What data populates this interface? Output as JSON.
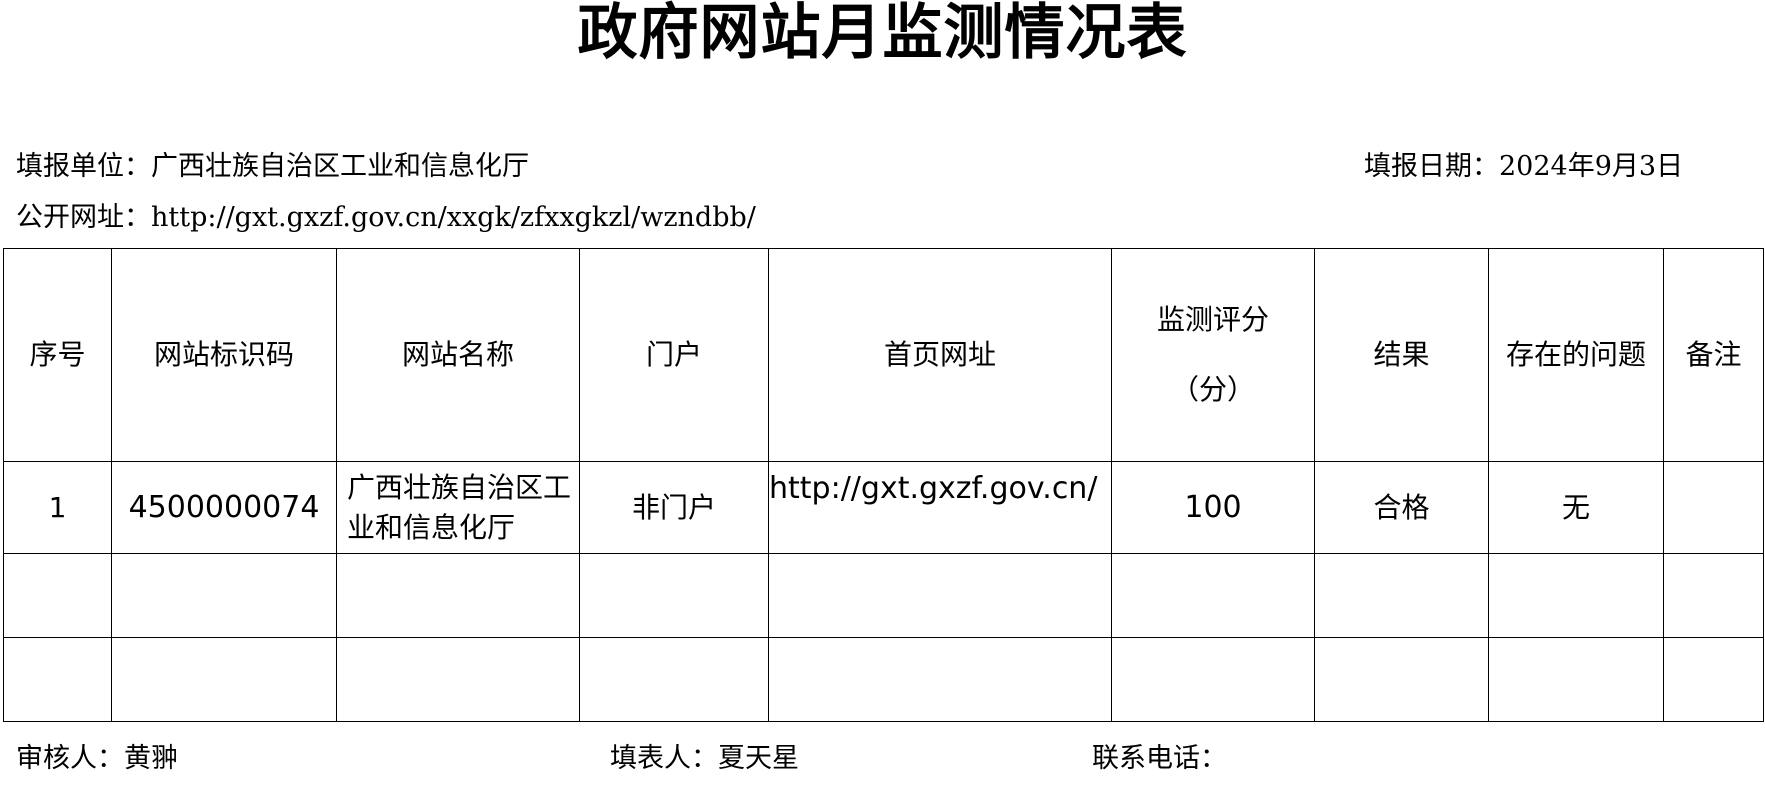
{
  "title": "政府网站月监测情况表",
  "meta": {
    "unit": "填报单位：广西壮族自治区工业和信息化厅",
    "date": "填报日期：2024年9月3日",
    "url": "公开网址：http://gxt.gxzf.gov.cn/xxgk/zfxxgkzl/wzndbb/"
  },
  "table": {
    "headers": {
      "index": "序号",
      "site_id": "网站标识码",
      "site_name": "网站名称",
      "portal": "门户",
      "homepage": "首页网址",
      "score_line1": "监测评分",
      "score_line2": "（分）",
      "result": "结果",
      "issues": "存在的问题",
      "remarks": "备注"
    },
    "rows": [
      {
        "index": "1",
        "site_id": "4500000074",
        "site_name": "广西壮族自治区工业和信息化厅",
        "portal": "非门户",
        "homepage": "http://gxt.gxzf.gov.cn/",
        "score": "100",
        "result": "合格",
        "issues": "无",
        "remarks": ""
      }
    ]
  },
  "footer": {
    "reviewer": "审核人：黄翀",
    "filler": "填表人：夏天星",
    "phone": "联系电话："
  }
}
